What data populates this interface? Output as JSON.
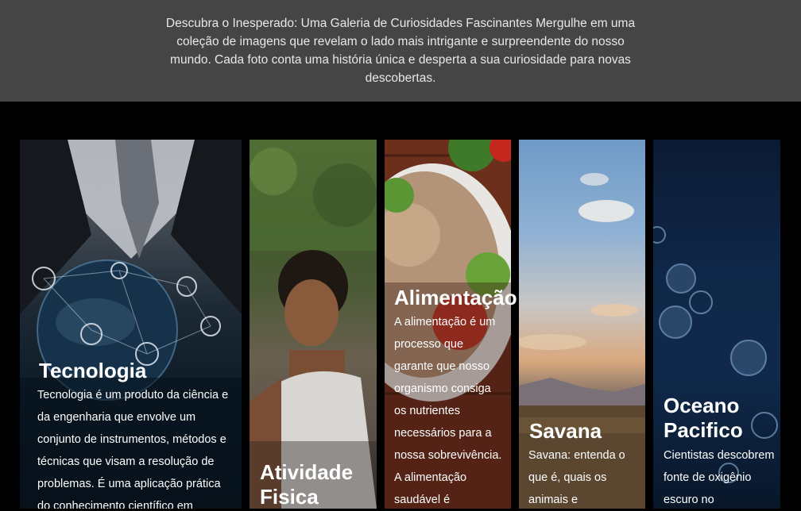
{
  "header": {
    "text": "Descubra o Inesperado: Uma Galeria de Curiosidades Fascinantes Mergulhe em uma coleção de imagens que revelam o lado mais intrigante e surpreendente do nosso mundo. Cada foto conta uma história única e desperta a sua curiosidade para novas descobertas."
  },
  "cards": [
    {
      "title": "Tecnologia",
      "text": "Tecnologia é um produto da ciência e da engenharia que envolve um conjunto de instrumentos, métodos e técnicas que visam a resolução de problemas. É uma aplicação prática do conhecimento científico em",
      "image": "business-globe-network"
    },
    {
      "title": "Atividade Fisica",
      "text": "",
      "image": "smiling-boy-outdoors"
    },
    {
      "title": "Alimentação",
      "text": "A alimentação é um processo que garante que nosso organismo consiga os nutrientes necessários para a nossa sobrevivência. A alimentação saudável é",
      "image": "quinoa-salad-bowl"
    },
    {
      "title": "Savana",
      "text": "Savana: entenda o que é, quais os animais e",
      "image": "savanna-sunset"
    },
    {
      "title": "Oceano Pacifico",
      "text": "Cientistas descobrem fonte de oxigênio escuro no",
      "image": "ocean-bubbles"
    }
  ]
}
